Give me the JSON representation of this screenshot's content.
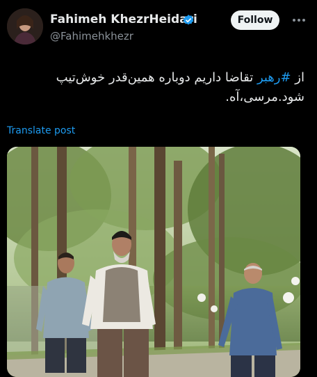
{
  "author": {
    "name": "Fahimeh KhezrHeidari",
    "handle": "@Fahimehkhezr"
  },
  "follow_label": "Follow",
  "tweet": {
    "prefix": "از ",
    "hashtag": "#رهبر",
    "body": " تقاضا داریم دوباره همین‌قدر خوش‌تیپ شود.مرسی،آه."
  },
  "translate_label": "Translate post",
  "colors": {
    "background": "#000000",
    "accent": "#1d9bf0",
    "text": "#e7e9ea",
    "muted": "#8b9299",
    "follow_bg": "#eff3f4"
  },
  "icons": {
    "verified": "verified-badge-icon",
    "more": "more-options-icon"
  }
}
